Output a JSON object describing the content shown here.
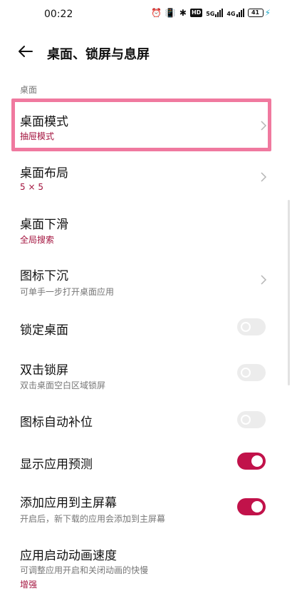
{
  "status_bar": {
    "time": "00:22",
    "icons": [
      "alarm-icon",
      "vibrate-icon",
      "bluetooth-icon",
      "hd-icon",
      "5g-signal-icon",
      "4g-signal-icon",
      "battery-icon",
      "charging-icon"
    ],
    "hd": "HD",
    "net1": "5G",
    "net2": "4G",
    "battery_level": "41",
    "colors": {
      "charging": "#1ea9c8"
    }
  },
  "header": {
    "title": "桌面、锁屏与息屏"
  },
  "section": {
    "label": "桌面"
  },
  "items": [
    {
      "title": "桌面模式",
      "value": "抽屉模式",
      "control": "chevron"
    },
    {
      "title": "桌面布局",
      "value": "5 × 5",
      "control": "chevron"
    },
    {
      "title": "桌面下滑",
      "value": "全局搜索",
      "control": "none"
    },
    {
      "title": "图标下沉",
      "subtitle": "可单手一步打开桌面应用",
      "control": "chevron"
    },
    {
      "title": "锁定桌面",
      "control": "toggle",
      "checked": false
    },
    {
      "title": "双击锁屏",
      "subtitle": "双击桌面空白区域锁屏",
      "control": "toggle",
      "checked": false
    },
    {
      "title": "图标自动补位",
      "control": "toggle",
      "checked": false
    },
    {
      "title": "显示应用预测",
      "control": "toggle",
      "checked": true
    },
    {
      "title": "添加应用到主屏幕",
      "subtitle": "开启后，新下载的应用会添加到主屏幕",
      "control": "toggle",
      "checked": true
    },
    {
      "title": "应用启动动画速度",
      "subtitle": "可调整应用开启和关闭动画的快慢",
      "value": "增强",
      "control": "none"
    }
  ],
  "theme": {
    "accent": "#c1124a",
    "value_text": "#a3133e",
    "highlight": "#f0799f"
  }
}
